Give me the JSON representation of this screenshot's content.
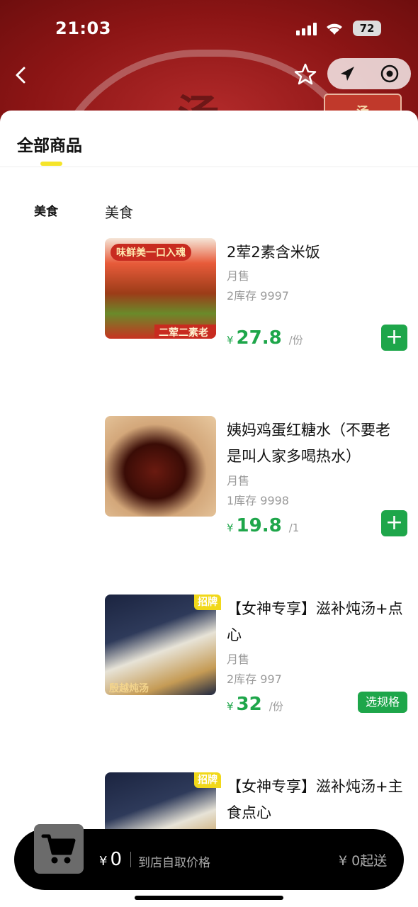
{
  "status": {
    "time": "21:03",
    "battery": "72"
  },
  "header": {
    "mini_card_text": "汤"
  },
  "tabs": {
    "all_goods": "全部商品"
  },
  "sidebar": {
    "category": "美食"
  },
  "section": {
    "title": "美食"
  },
  "items": [
    {
      "name": "2荤2素含米饭",
      "monthly": "月售",
      "stock": "2库存 9997",
      "yen": "¥",
      "price": "27.8",
      "unit": "/份",
      "thumb_text_top": "味鲜美一口入魂",
      "thumb_text_bottom": "二荤二素老盒饭",
      "action": "+"
    },
    {
      "name": "姨妈鸡蛋红糖水（不要老是叫人家多喝热水）",
      "monthly": "月售",
      "stock": "1库存 9998",
      "yen": "¥",
      "price": "19.8",
      "unit": "/1",
      "action": "+"
    },
    {
      "name": "【女神专享】滋补炖汤+点心",
      "monthly": "月售",
      "stock": "2库存 997",
      "yen": "¥",
      "price": "32",
      "unit": "/份",
      "badge": "招牌",
      "thumb_text_bottom": "殷越炖汤",
      "action": "选规格"
    },
    {
      "name": "【女神专享】滋补炖汤+主食点心",
      "badge": "招牌"
    }
  ],
  "cart": {
    "yen": "¥",
    "amount": "0",
    "note": "到店自取价格",
    "min_order": "¥ 0起送"
  }
}
